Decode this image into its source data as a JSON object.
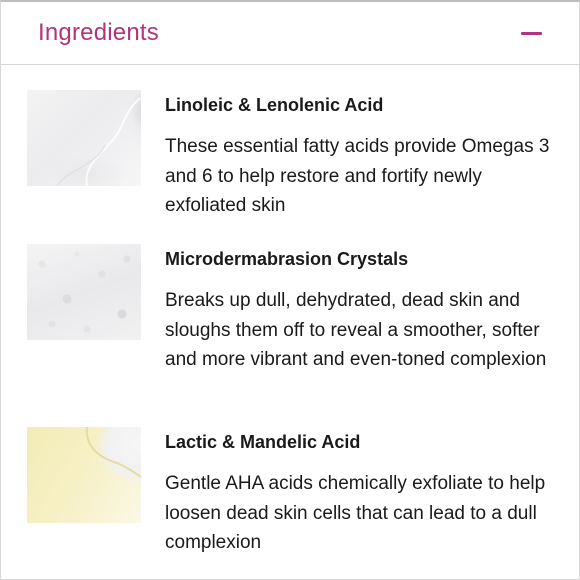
{
  "section": {
    "title": "Ingredients",
    "accent_color": "#b0357a",
    "collapse_icon": "minus-icon"
  },
  "ingredients": [
    {
      "name": "Linoleic & Lenolenic Acid",
      "description": "These essential fatty acids provide Omegas 3 and 6 to help restore and fortify newly exfoliated skin",
      "image": "oil-droplet-texture"
    },
    {
      "name": "Microdermabrasion Crystals",
      "description": "Breaks up dull, dehydrated, dead skin and sloughs them off to reveal a smoother, softer and more vibrant and even-toned complexion",
      "image": "white-crystal-texture"
    },
    {
      "name": "Lactic & Mandelic Acid",
      "description": "Gentle AHA acids chemically exfoliate to help loosen dead skin cells that can lead to a dull complexion",
      "image": "yellow-serum-texture"
    }
  ]
}
